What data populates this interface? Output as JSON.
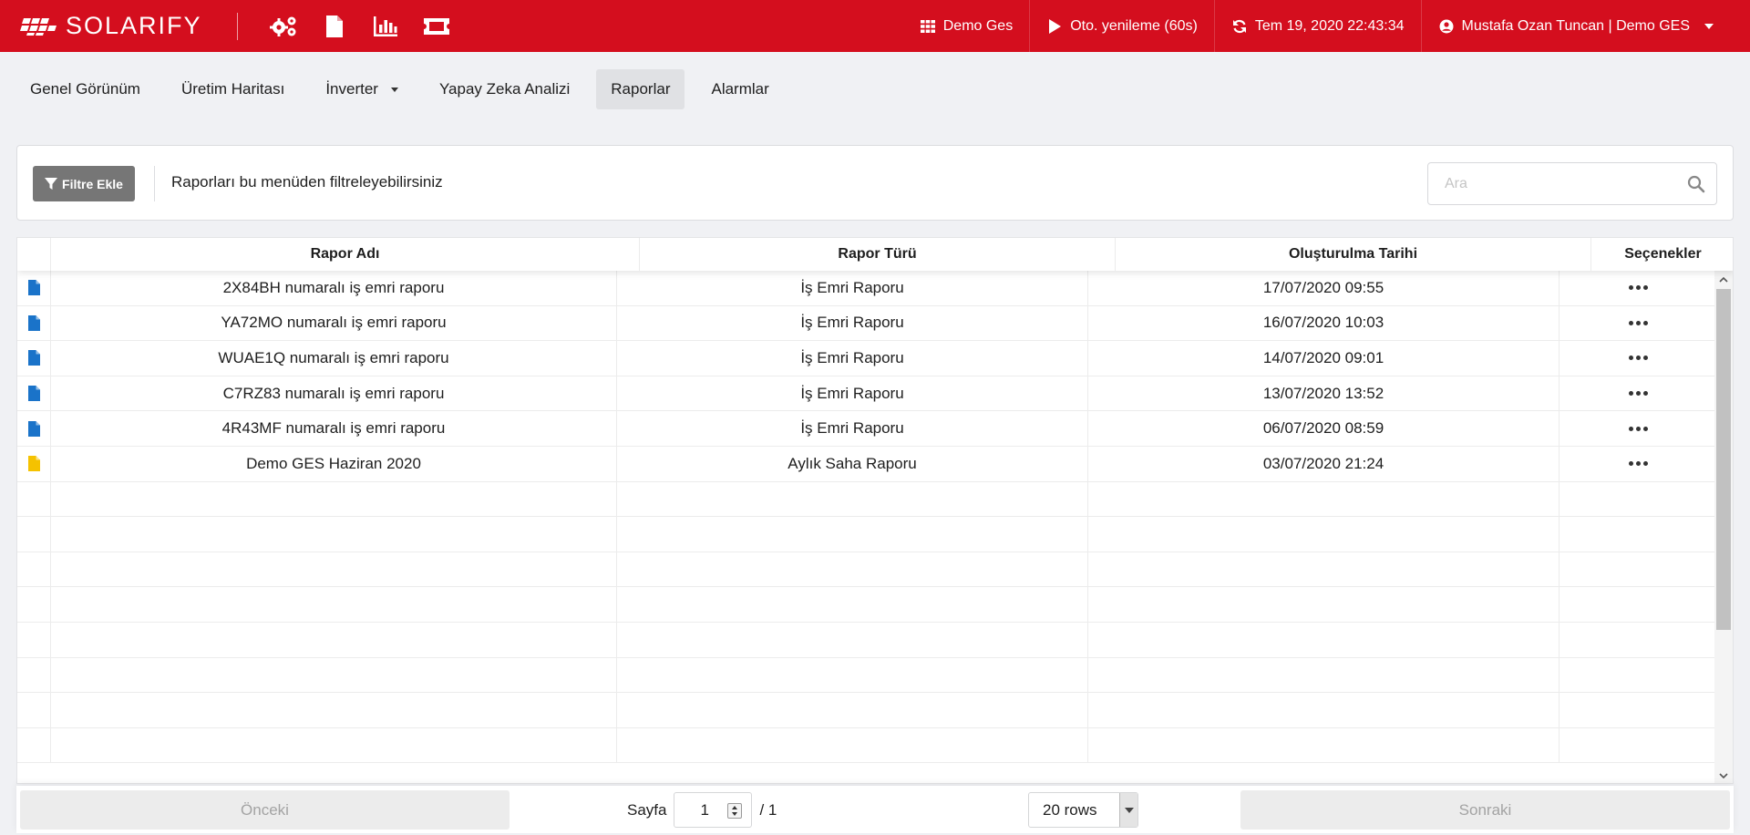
{
  "brand": {
    "name": "SOLARIFY"
  },
  "colors": {
    "brand_red": "#d40e1e",
    "doc_blue": "#1a73c9",
    "doc_yellow": "#f5c200"
  },
  "toolbar_icons": [
    "settings-gears-icon",
    "file-icon",
    "bar-chart-icon",
    "ticket-icon"
  ],
  "top_right": {
    "site": "Demo Ges",
    "auto_refresh": "Oto. yenileme (60s)",
    "datetime": "Tem 19, 2020 22:43:34",
    "user": "Mustafa Ozan Tuncan | Demo GES"
  },
  "nav": {
    "items": [
      {
        "label": "Genel Görünüm"
      },
      {
        "label": "Üretim Haritası"
      },
      {
        "label": "İnverter"
      },
      {
        "label": "Yapay Zeka Analizi"
      },
      {
        "label": "Raporlar"
      },
      {
        "label": "Alarmlar"
      }
    ],
    "active": "Raporlar"
  },
  "filter": {
    "button_label": "Filtre Ekle",
    "hint": "Raporları bu menüden filtreleyebilirsiniz",
    "search_placeholder": "Ara"
  },
  "table": {
    "columns": [
      "Rapor Adı",
      "Rapor Türü",
      "Oluşturulma Tarihi",
      "Seçenekler"
    ],
    "rows": [
      {
        "icon": "doc-blue",
        "name": "2X84BH numaralı iş emri raporu",
        "type": "İş Emri Raporu",
        "date": "17/07/2020 09:55"
      },
      {
        "icon": "doc-blue",
        "name": "YA72MO numaralı iş emri raporu",
        "type": "İş Emri Raporu",
        "date": "16/07/2020 10:03"
      },
      {
        "icon": "doc-blue",
        "name": "WUAE1Q numaralı iş emri raporu",
        "type": "İş Emri Raporu",
        "date": "14/07/2020 09:01"
      },
      {
        "icon": "doc-blue",
        "name": "C7RZ83 numaralı iş emri raporu",
        "type": "İş Emri Raporu",
        "date": "13/07/2020 13:52"
      },
      {
        "icon": "doc-blue",
        "name": "4R43MF numaralı iş emri raporu",
        "type": "İş Emri Raporu",
        "date": "06/07/2020 08:59"
      },
      {
        "icon": "doc-yellow",
        "name": "Demo GES Haziran 2020",
        "type": "Aylık Saha Raporu",
        "date": "03/07/2020 21:24"
      }
    ]
  },
  "pagination": {
    "prev": "Önceki",
    "next": "Sonraki",
    "page_label": "Sayfa",
    "current_page": "1",
    "total_pages": "/ 1",
    "rows_option": "20 rows"
  }
}
